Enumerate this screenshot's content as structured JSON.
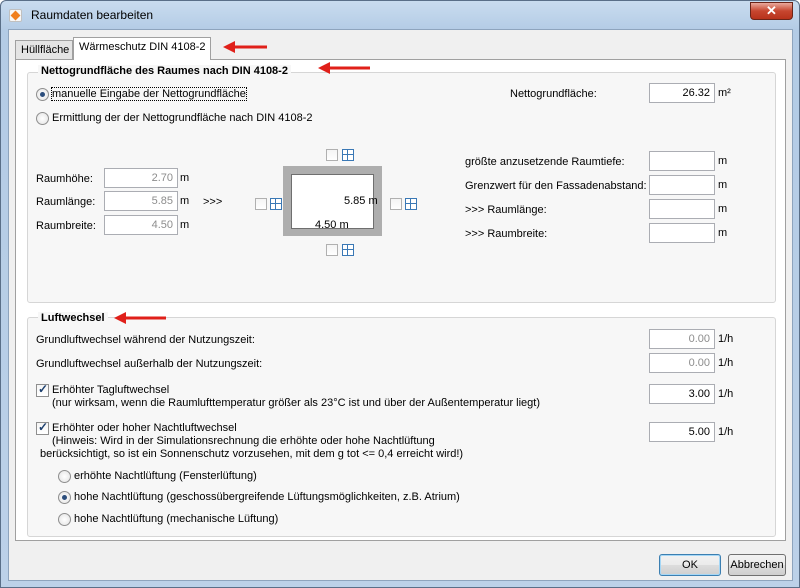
{
  "window": {
    "title": "Raumdaten bearbeiten",
    "close_glyph": "✕"
  },
  "tabs": [
    {
      "label": "Hüllfläche",
      "active": false
    },
    {
      "label": "Wärmeschutz DIN 4108-2",
      "active": true
    }
  ],
  "net_area": {
    "title": "Nettogrundfläche des Raumes nach DIN 4108-2",
    "radio_manual": "manuelle Eingabe der Nettogrundfläche",
    "radio_manual_checked": true,
    "radio_calc": "Ermittlung der der Nettogrundfläche nach DIN 4108-2",
    "net_area_label": "Nettogrundfläche:",
    "net_area_value": "26.32",
    "net_area_unit": "m²",
    "height_label": "Raumhöhe:",
    "height_value": "2.70",
    "length_label": "Raumlänge:",
    "length_value": "5.85",
    "width_label": "Raumbreite:",
    "width_value": "4.50",
    "unit_m": "m",
    "chevrons": ">>>",
    "diagram_length": "5.85 m",
    "diagram_width": "4.50 m",
    "max_depth_label": "größte anzusetzende Raumtiefe:",
    "facade_limit_label": "Grenzwert für den Fassadenabstand:",
    "calc_length_label": ">>> Raumlänge:",
    "calc_width_label": ">>> Raumbreite:"
  },
  "air_change": {
    "title": "Luftwechsel",
    "base_during_label": "Grundluftwechsel während der Nutzungszeit:",
    "base_during_value": "0.00",
    "base_outside_label": "Grundluftwechsel außerhalb der Nutzungszeit:",
    "base_outside_value": "0.00",
    "unit": "1/h",
    "day_label": "Erhöhter Tagluftwechsel",
    "day_note": "(nur wirksam, wenn die Raumlufttemperatur größer als 23°C ist und über der Außentemperatur liegt)",
    "day_value": "3.00",
    "day_checked": true,
    "night_label": "Erhöhter oder hoher Nachtluftwechsel",
    "night_note_1": "(Hinweis: Wird in der Simulationsrechnung die erhöhte oder hohe Nachtlüftung",
    "night_note_2": "berücksichtigt, so ist ein Sonnenschutz vorzusehen, mit dem g tot <= 0,4 erreicht wird!)",
    "night_value": "5.00",
    "night_checked": true,
    "option_1": "erhöhte Nachtlüftung (Fensterlüftung)",
    "option_2": "hohe Nachtlüftung (geschossübergreifende Lüftungsmöglichkeiten, z.B. Atrium)",
    "option_3": "hohe Nachtlüftung (mechanische Lüftung)",
    "selected_option": 2
  },
  "buttons": {
    "ok": "OK",
    "cancel": "Abbrechen"
  },
  "colors": {
    "annotation_arrow": "#e0201a",
    "window_icon": "#3a78b5"
  }
}
